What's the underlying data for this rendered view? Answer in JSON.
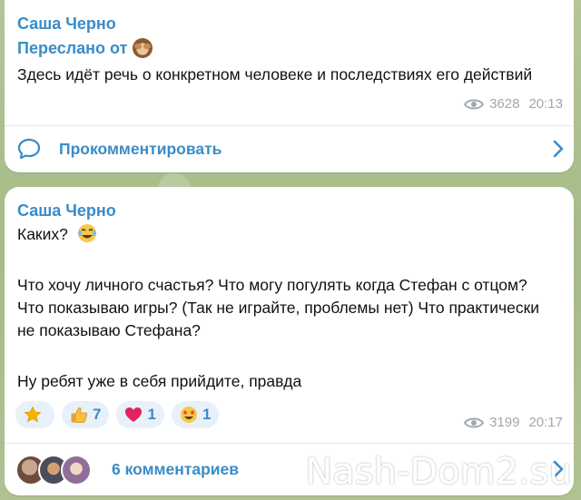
{
  "post1": {
    "author": "Саша Черно",
    "forwarded_label": "Переслано от",
    "text": "Здесь идёт речь о конкретном человеке и последствиях его действий",
    "views": "3628",
    "time": "20:13",
    "comment_action": "Прокомментировать"
  },
  "post2": {
    "author": "Саша Черно",
    "line1": "Каких?",
    "paragraph2": "Что хочу личного счастья? Что могу погулять когда Стефан с отцом? Что показываю игры? (Так не играйте, проблемы нет) Что практически не показываю Стефана?",
    "paragraph3": "Ну ребят уже в себя прийдите, правда",
    "reactions": [
      {
        "icon": "star-icon",
        "count": ""
      },
      {
        "icon": "thumbs-up-icon",
        "count": "7"
      },
      {
        "icon": "heart-icon",
        "count": "1"
      },
      {
        "icon": "star-struck-icon",
        "count": "1"
      }
    ],
    "views": "3199",
    "time": "20:17",
    "comments_label": "6 комментариев"
  },
  "watermark": "Nash-Dom2.su",
  "colors": {
    "accent": "#3b8cc6",
    "meta": "#a0a8ae",
    "heart": "#e0245e"
  }
}
